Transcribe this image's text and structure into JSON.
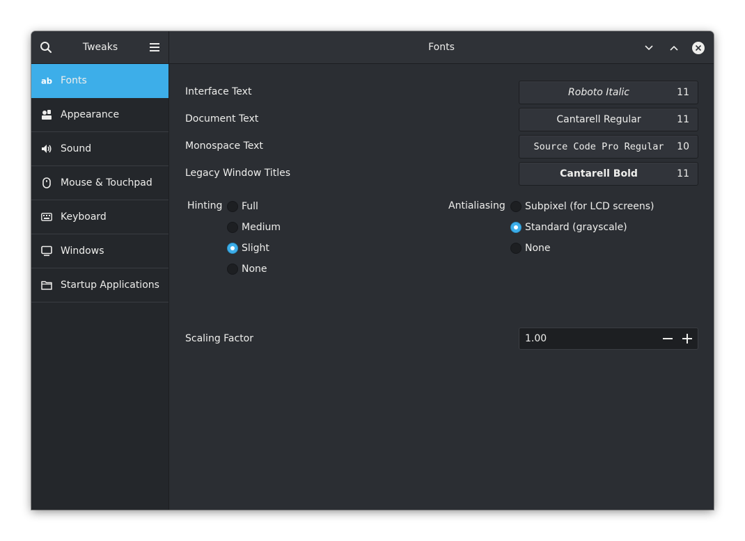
{
  "sidebar_header": {
    "title": "Tweaks"
  },
  "headerbar": {
    "title": "Fonts"
  },
  "sidebar": {
    "items": [
      {
        "label": "Fonts",
        "icon": "font-ab-icon",
        "active": true
      },
      {
        "label": "Appearance",
        "icon": "appearance-icon"
      },
      {
        "label": "Sound",
        "icon": "speaker-icon"
      },
      {
        "label": "Mouse & Touchpad",
        "icon": "mouse-icon"
      },
      {
        "label": "Keyboard",
        "icon": "keyboard-icon"
      },
      {
        "label": "Windows",
        "icon": "monitor-icon"
      },
      {
        "label": "Startup Applications",
        "icon": "folder-icon"
      }
    ]
  },
  "fonts": {
    "interface": {
      "label": "Interface Text",
      "font": "Roboto Italic",
      "size": "11"
    },
    "document": {
      "label": "Document Text",
      "font": "Cantarell Regular",
      "size": "11"
    },
    "monospace": {
      "label": "Monospace Text",
      "font": "Source Code Pro Regular",
      "size": "10"
    },
    "legacy": {
      "label": "Legacy Window Titles",
      "font": "Cantarell Bold",
      "size": "11"
    }
  },
  "hinting": {
    "label": "Hinting",
    "options": [
      "Full",
      "Medium",
      "Slight",
      "None"
    ],
    "selected": "Slight"
  },
  "antialiasing": {
    "label": "Antialiasing",
    "options": [
      "Subpixel (for LCD screens)",
      "Standard (grayscale)",
      "None"
    ],
    "selected": "Standard (grayscale)"
  },
  "scaling": {
    "label": "Scaling Factor",
    "value": "1.00"
  },
  "colors": {
    "accent": "#3daee9",
    "window_bg": "#2b2e33",
    "sidebar_bg": "#24272b",
    "text": "#eeeeec"
  }
}
